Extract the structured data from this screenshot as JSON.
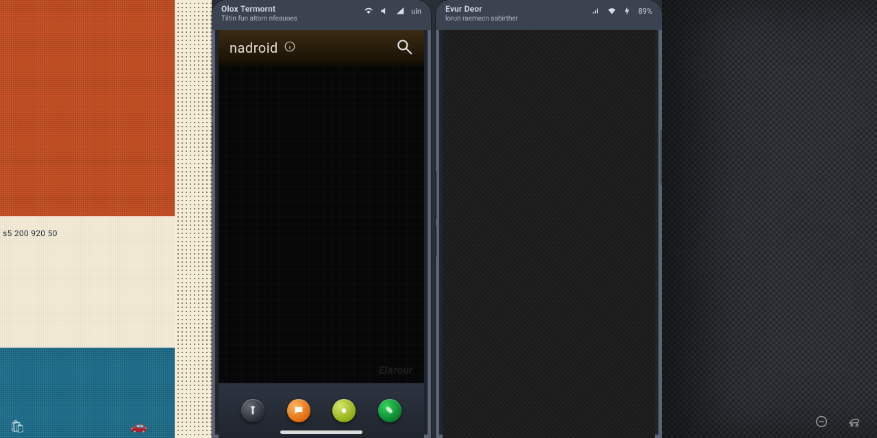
{
  "swatch_code": "s5 200 920 50",
  "phoneA": {
    "status": {
      "title": "Olox Termornt",
      "subtitle": "Tiltin fun altorn nfeauoes",
      "battery": "uin"
    },
    "app": {
      "title": "nadroid",
      "watermark": "Elarour"
    },
    "dock": {
      "items": [
        {
          "name": "flashlight",
          "color": "dark"
        },
        {
          "name": "chat",
          "color": "orange"
        },
        {
          "name": "voice",
          "color": "lime"
        },
        {
          "name": "phone",
          "color": "green"
        }
      ]
    }
  },
  "phoneB": {
    "status": {
      "title": "Evur Deor",
      "subtitle": "lorun raemecn sabirther",
      "battery": "89%"
    }
  }
}
